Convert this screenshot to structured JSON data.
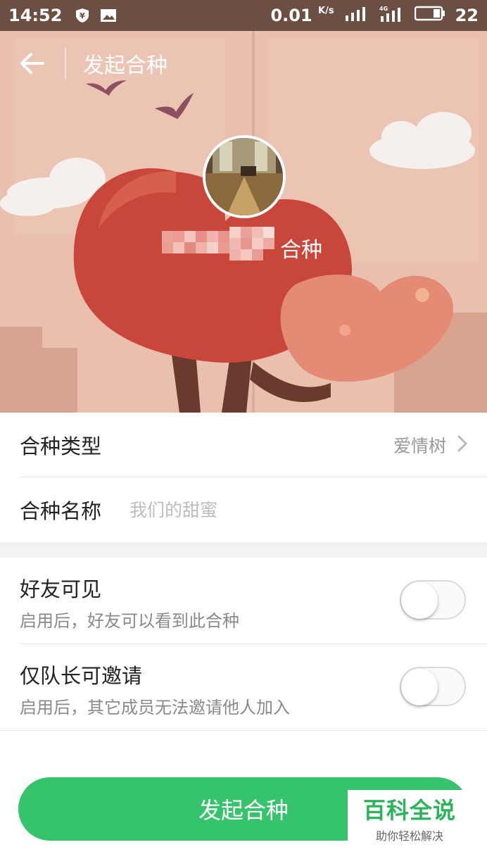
{
  "status_bar": {
    "time": "14:52",
    "net_speed": "0.01",
    "net_unit": "K/s",
    "battery": "22"
  },
  "header": {
    "title": "发起合种"
  },
  "profile": {
    "tree_name_suffix": "合种"
  },
  "form": {
    "type_label": "合种类型",
    "type_value": "爱情树",
    "name_label": "合种名称",
    "name_placeholder": "我们的甜蜜"
  },
  "settings": [
    {
      "title": "好友可见",
      "desc": "启用后，好友可以看到此合种",
      "enabled": false
    },
    {
      "title": "仅队长可邀请",
      "desc": "启用后，其它成员无法邀请他人加入",
      "enabled": false
    }
  ],
  "submit_label": "发起合种",
  "watermark": {
    "title": "百科全说",
    "subtitle": "助你轻松解决"
  },
  "colors": {
    "accent": "#35c36c",
    "status_bar": "#6b4f43"
  }
}
